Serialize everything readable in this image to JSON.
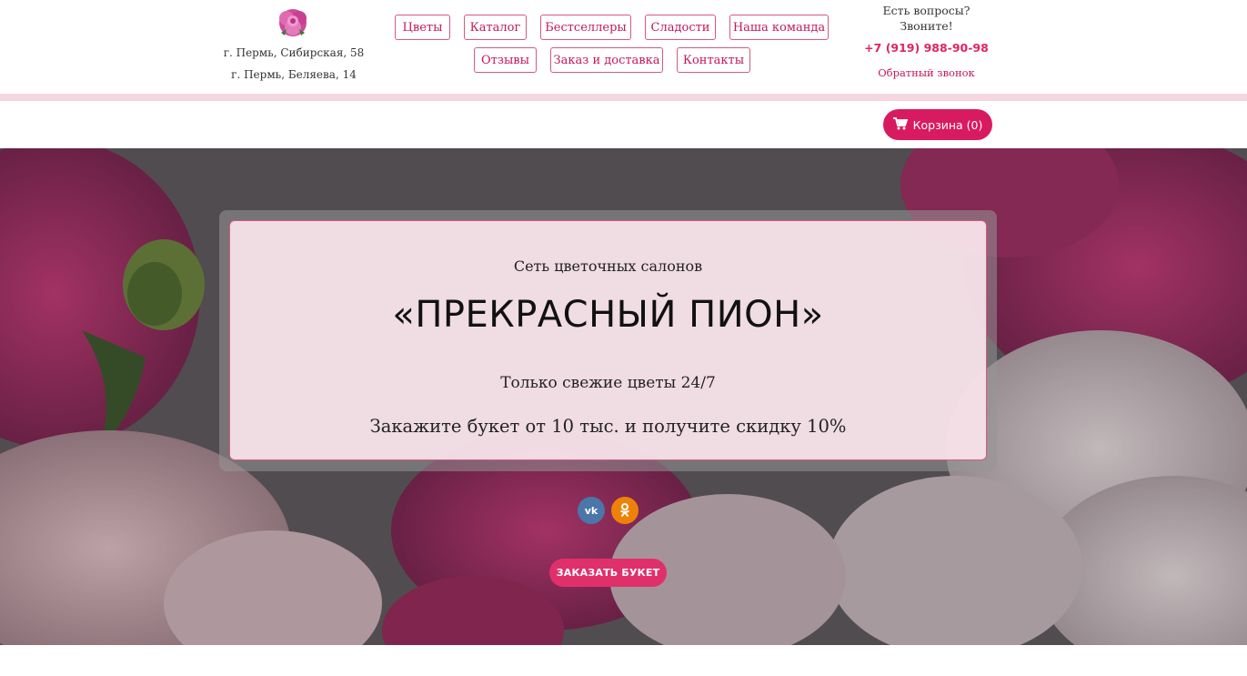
{
  "header": {
    "logo_icon": "peony-flower-logo",
    "addresses": [
      "г. Пермь, Сибирская, 58",
      "г. Пермь, Беляева, 14"
    ],
    "contact_question": [
      "Есть вопросы?",
      "Звоните!"
    ],
    "phone": "+7 (919) 988-90-98",
    "callback_label": "Обратный звонок"
  },
  "nav": {
    "row1": [
      "Цветы",
      "Каталог",
      "Бестселлеры",
      "Сладости",
      "Наша команда"
    ],
    "row2": [
      "Отзывы",
      "Заказ и доставка",
      "Контакты"
    ]
  },
  "cart": {
    "icon": "shopping-cart-icon",
    "label": "Корзина (0)"
  },
  "hero": {
    "subtitle": "Сеть цветочных салонов",
    "title": "«ПРЕКРАСНЫЙ ПИОН»",
    "line1": "Только свежие цветы 24/7",
    "line2": "Закажите букет от 10 тыс. и получите скидку 10%",
    "social": [
      {
        "name": "vk-icon",
        "label": "vk"
      },
      {
        "name": "odnoklassniki-icon",
        "label": "ok"
      }
    ],
    "order_button": "ЗАКАЗАТЬ БУКЕТ"
  },
  "colors": {
    "accent": "#d81b60",
    "nav_border": "#d5597f",
    "rule": "#f6d6e0",
    "vk": "#4a76a8",
    "ok": "#ee8208"
  }
}
